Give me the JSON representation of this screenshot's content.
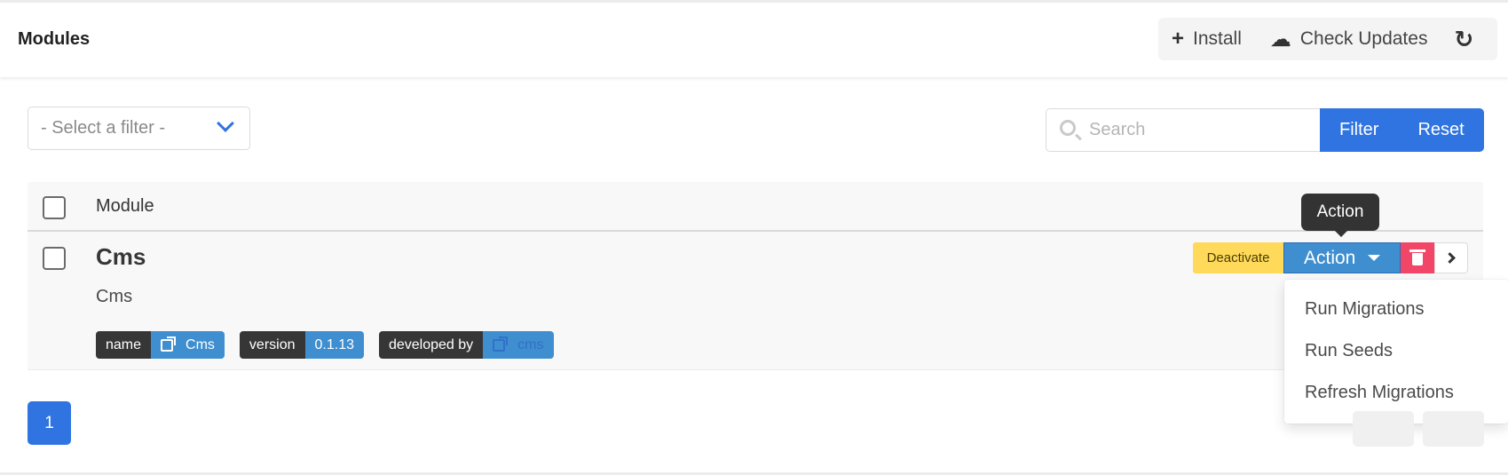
{
  "header": {
    "title": "Modules",
    "install_label": "Install",
    "check_updates_label": "Check Updates"
  },
  "filters": {
    "select_placeholder": "- Select a filter -",
    "search_placeholder": "Search",
    "filter_label": "Filter",
    "reset_label": "Reset"
  },
  "table": {
    "column_module": "Module",
    "rows": [
      {
        "name": "Cms",
        "description": "Cms",
        "tags": [
          {
            "key": "name",
            "value": "Cms"
          },
          {
            "key": "version",
            "value": "0.1.13"
          },
          {
            "key": "developed by",
            "value": "cms"
          }
        ],
        "deactivate_label": "Deactivate",
        "action_label": "Action"
      }
    ]
  },
  "tooltip": "Action",
  "dropdown": {
    "items": [
      "Run Migrations",
      "Run Seeds",
      "Refresh Migrations"
    ]
  },
  "pagination": {
    "current_page": "1"
  },
  "colors": {
    "primary": "#2f74e0",
    "info": "#3e8ed0",
    "warning": "#ffd95a",
    "danger": "#f14668",
    "dark": "#363636"
  },
  "icons": [
    "plus-icon",
    "cloud-download-icon",
    "refresh-icon",
    "chevron-down-icon",
    "search-icon",
    "external-link-icon",
    "caret-down-icon",
    "trash-icon",
    "chevron-right-icon"
  ]
}
